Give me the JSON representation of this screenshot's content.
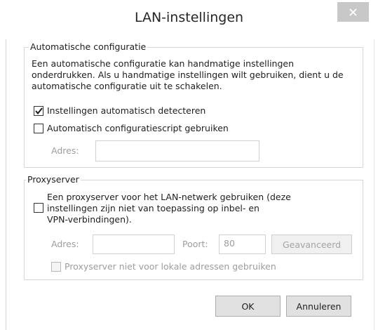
{
  "window": {
    "title": "LAN-instellingen",
    "close_icon": "close-icon"
  },
  "auto_config": {
    "legend": "Automatische configuratie",
    "description_lines": [
      "Een automatische configuratie kan handmatige instellingen",
      "onderdrukken. Als u handmatige instellingen wilt gebruiken, dient u de",
      "automatische configuratie uit te schakelen."
    ],
    "detect_label": "Instellingen automatisch detecteren",
    "detect_checked": true,
    "script_label": "Automatisch configuratiescript gebruiken",
    "script_checked": false,
    "address_label": "Adres:",
    "address_value": ""
  },
  "proxy": {
    "legend": "Proxyserver",
    "use_proxy_lines": [
      "Een proxyserver voor het LAN-netwerk gebruiken (deze",
      "instellingen zijn niet van toepassing op inbel- en",
      "VPN-verbindingen)."
    ],
    "use_proxy_checked": false,
    "address_label": "Adres:",
    "address_value": "",
    "port_label": "Poort:",
    "port_value": "80",
    "advanced_button": "Geavanceerd",
    "bypass_label": "Proxyserver niet voor lokale adressen gebruiken",
    "bypass_checked": false
  },
  "footer": {
    "ok_button": "OK",
    "cancel_button": "Annuleren"
  },
  "colors": {
    "disabled_text": "#9d9d9d",
    "button_face": "#e1e1e1",
    "close_button": "#c8c8c8"
  }
}
